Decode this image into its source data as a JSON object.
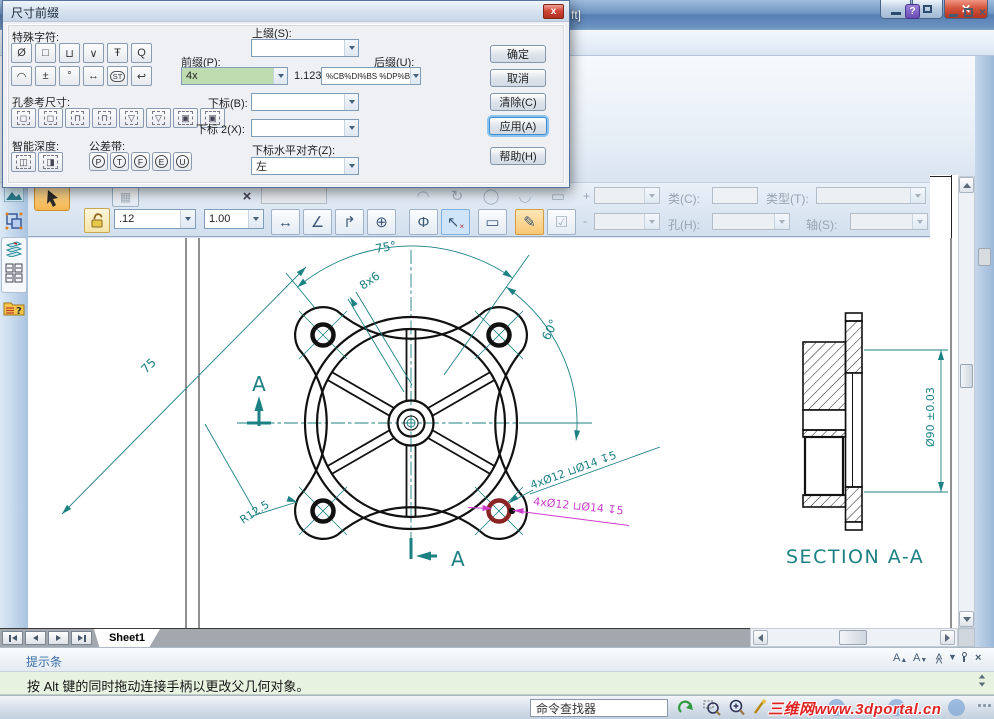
{
  "window": {
    "title_tail": "ft]"
  },
  "dialog": {
    "title": "尺寸前缀",
    "close_glyph": "x",
    "special_label": "特殊字符:",
    "special_row1": [
      "Ø",
      "□",
      "⊔",
      "∨",
      "Ŧ",
      "Q"
    ],
    "special_row2": [
      "◠",
      "±",
      "°",
      "↔",
      "ST",
      "↩"
    ],
    "hole_ref_label": "孔参考尺寸:",
    "hole_ref_icons": [
      "◻",
      "◻",
      "⊓",
      "⊓",
      "▽",
      "▽",
      "▣",
      "▣"
    ],
    "smart_depth_label": "智能深度:",
    "smart_depth_icons": [
      "◫",
      "◨"
    ],
    "tolerance_label": "公差带:",
    "tolerance_icons": [
      "P",
      "T",
      "F",
      "E",
      "U"
    ],
    "superfix_label": "上缀(S):",
    "prefix_label": "前缀(P):",
    "prefix_value": "4x",
    "sample_value": "1.123",
    "suffix_label": "后缀(U):",
    "suffix_value": "%CB%DI%BS %DP%B",
    "subscript_label": "下标(B):",
    "subscript2_label": "下标 2(X):",
    "sub_align_label": "下标水平对齐(Z):",
    "sub_align_value": "左",
    "btn_ok": "确定",
    "btn_cancel": "取消",
    "btn_clear": "清除(C)",
    "btn_apply": "应用(A)",
    "btn_help": "帮助(H)"
  },
  "toolbar": {
    "style_value": ".12",
    "scale_value": "1.00",
    "plus": "+",
    "minus": "-",
    "class_label": "类(C):",
    "type_label": "类型(T):",
    "hole_label": "孔(H):",
    "shaft_label": "轴(S):",
    "dim_icons": [
      "↔",
      "∠",
      "↱",
      "⊕",
      "Φ",
      "↖",
      "▭",
      "✎",
      "☑"
    ],
    "row1_icons": [
      "◠",
      "↻",
      "◯",
      "◡",
      "▭"
    ]
  },
  "drawing": {
    "dim_angle_top": "75°",
    "dim_spoke": "8x6",
    "dim_left": "75",
    "dim_angle_right": "60°",
    "dim_radius": "R12.5",
    "dim_hole": "4xØ12 ⊔Ø14 ↧5",
    "dim_hole_selected": "4xØ12 ⊔Ø14 ↧5",
    "marker_a1": "A",
    "marker_a2": "A",
    "section_label": "SECTION A-A",
    "dim_section": "Ø90 ±0.03",
    "colors": {
      "dim": "#1d8083",
      "selected": "#cc3fcc",
      "highlight": "#8b2424"
    }
  },
  "sheet": {
    "tab": "Sheet1"
  },
  "hint": {
    "title": "提示条",
    "text": "按 Alt 键的同时拖动连接手柄以更改父几何对象。"
  },
  "status": {
    "finder": "命令查找器",
    "watermark": "三维网www.3dportal.cn"
  }
}
